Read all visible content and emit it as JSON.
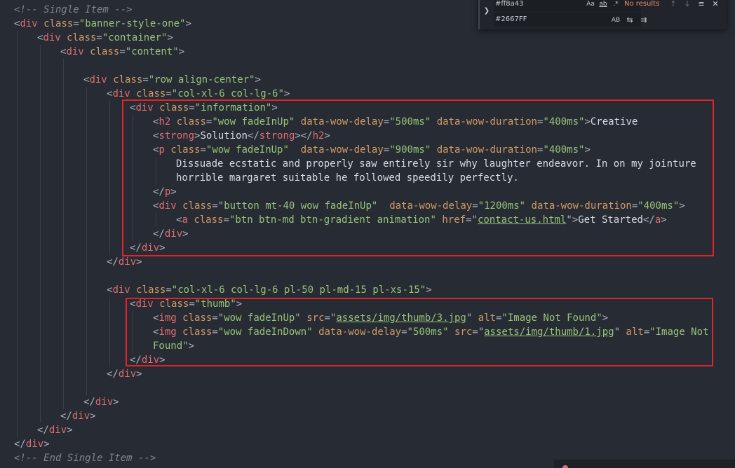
{
  "editor": {
    "lines": [
      {
        "indent": 0,
        "tokens": [
          [
            "comment",
            "<!-- Single Item -->"
          ]
        ]
      },
      {
        "indent": 0,
        "tokens": [
          [
            "punct",
            "<"
          ],
          [
            "tag",
            "div"
          ],
          [
            "punct",
            " "
          ],
          [
            "attr",
            "class"
          ],
          [
            "punct",
            "="
          ],
          [
            "string",
            "\"banner-style-one\""
          ],
          [
            "punct",
            ">"
          ]
        ]
      },
      {
        "indent": 1,
        "tokens": [
          [
            "punct",
            "<"
          ],
          [
            "tag",
            "div"
          ],
          [
            "punct",
            " "
          ],
          [
            "attr",
            "class"
          ],
          [
            "punct",
            "="
          ],
          [
            "string",
            "\"container\""
          ],
          [
            "punct",
            ">"
          ]
        ]
      },
      {
        "indent": 2,
        "tokens": [
          [
            "punct",
            "<"
          ],
          [
            "tag",
            "div"
          ],
          [
            "punct",
            " "
          ],
          [
            "attr",
            "class"
          ],
          [
            "punct",
            "="
          ],
          [
            "string",
            "\"content\""
          ],
          [
            "punct",
            ">"
          ]
        ]
      },
      {
        "indent": 3,
        "tokens": []
      },
      {
        "indent": 3,
        "tokens": [
          [
            "punct",
            "<"
          ],
          [
            "tag",
            "div"
          ],
          [
            "punct",
            " "
          ],
          [
            "attr",
            "class"
          ],
          [
            "punct",
            "="
          ],
          [
            "string",
            "\"row align-center\""
          ],
          [
            "punct",
            ">"
          ]
        ]
      },
      {
        "indent": 4,
        "tokens": [
          [
            "punct",
            "<"
          ],
          [
            "tag",
            "div"
          ],
          [
            "punct",
            " "
          ],
          [
            "attr",
            "class"
          ],
          [
            "punct",
            "="
          ],
          [
            "string",
            "\"col-xl-6 col-lg-6\""
          ],
          [
            "punct",
            ">"
          ]
        ]
      },
      {
        "indent": 5,
        "tokens": [
          [
            "punct",
            "<"
          ],
          [
            "tag",
            "div"
          ],
          [
            "punct",
            " "
          ],
          [
            "attr",
            "class"
          ],
          [
            "punct",
            "="
          ],
          [
            "string",
            "\"information\""
          ],
          [
            "punct",
            ">"
          ]
        ]
      },
      {
        "indent": 6,
        "tokens": [
          [
            "punct",
            "<"
          ],
          [
            "tag",
            "h2"
          ],
          [
            "punct",
            " "
          ],
          [
            "attr",
            "class"
          ],
          [
            "punct",
            "="
          ],
          [
            "string",
            "\"wow fadeInUp\""
          ],
          [
            "punct",
            " "
          ],
          [
            "attr",
            "data-wow-delay"
          ],
          [
            "punct",
            "="
          ],
          [
            "string",
            "\"500ms\""
          ],
          [
            "punct",
            " "
          ],
          [
            "attr",
            "data-wow-duration"
          ],
          [
            "punct",
            "="
          ],
          [
            "string",
            "\"400ms\""
          ],
          [
            "punct",
            ">"
          ],
          [
            "text",
            "Creative"
          ]
        ]
      },
      {
        "indent": 6,
        "tokens": [
          [
            "punct",
            "<"
          ],
          [
            "tag",
            "strong"
          ],
          [
            "punct",
            ">"
          ],
          [
            "text",
            "Solution"
          ],
          [
            "punct",
            "</"
          ],
          [
            "tag",
            "strong"
          ],
          [
            "punct",
            "></"
          ],
          [
            "tag",
            "h2"
          ],
          [
            "punct",
            ">"
          ]
        ]
      },
      {
        "indent": 6,
        "tokens": [
          [
            "punct",
            "<"
          ],
          [
            "tag",
            "p"
          ],
          [
            "punct",
            " "
          ],
          [
            "attr",
            "class"
          ],
          [
            "punct",
            "="
          ],
          [
            "string",
            "\"wow fadeInUp\""
          ],
          [
            "punct",
            "  "
          ],
          [
            "attr",
            "data-wow-delay"
          ],
          [
            "punct",
            "="
          ],
          [
            "string",
            "\"900ms\""
          ],
          [
            "punct",
            " "
          ],
          [
            "attr",
            "data-wow-duration"
          ],
          [
            "punct",
            "="
          ],
          [
            "string",
            "\"400ms\""
          ],
          [
            "punct",
            ">"
          ]
        ]
      },
      {
        "indent": 7,
        "tokens": [
          [
            "text",
            "Dissuade ecstatic and properly saw entirely sir why laughter endeavor. In on my jointure"
          ]
        ]
      },
      {
        "indent": 7,
        "tokens": [
          [
            "text",
            "horrible margaret suitable he followed speedily perfectly."
          ]
        ]
      },
      {
        "indent": 6,
        "tokens": [
          [
            "punct",
            "</"
          ],
          [
            "tag",
            "p"
          ],
          [
            "punct",
            ">"
          ]
        ]
      },
      {
        "indent": 6,
        "tokens": [
          [
            "punct",
            "<"
          ],
          [
            "tag",
            "div"
          ],
          [
            "punct",
            " "
          ],
          [
            "attr",
            "class"
          ],
          [
            "punct",
            "="
          ],
          [
            "string",
            "\"button mt-40 wow fadeInUp\""
          ],
          [
            "punct",
            "  "
          ],
          [
            "attr",
            "data-wow-delay"
          ],
          [
            "punct",
            "="
          ],
          [
            "string",
            "\"1200ms\""
          ],
          [
            "punct",
            " "
          ],
          [
            "attr",
            "data-wow-duration"
          ],
          [
            "punct",
            "="
          ],
          [
            "string",
            "\"400ms\""
          ],
          [
            "punct",
            ">"
          ]
        ]
      },
      {
        "indent": 7,
        "tokens": [
          [
            "punct",
            "<"
          ],
          [
            "tag",
            "a"
          ],
          [
            "punct",
            " "
          ],
          [
            "attr",
            "class"
          ],
          [
            "punct",
            "="
          ],
          [
            "string",
            "\"btn btn-md btn-gradient animation\""
          ],
          [
            "punct",
            " "
          ],
          [
            "attr",
            "href"
          ],
          [
            "punct",
            "=\""
          ],
          [
            "link",
            "contact-us.html"
          ],
          [
            "punct",
            "\">"
          ],
          [
            "text",
            "Get Started"
          ],
          [
            "punct",
            "</"
          ],
          [
            "tag",
            "a"
          ],
          [
            "punct",
            ">"
          ]
        ]
      },
      {
        "indent": 6,
        "tokens": [
          [
            "punct",
            "</"
          ],
          [
            "tag",
            "div"
          ],
          [
            "punct",
            ">"
          ]
        ]
      },
      {
        "indent": 5,
        "tokens": [
          [
            "punct",
            "</"
          ],
          [
            "tag",
            "div"
          ],
          [
            "punct",
            ">"
          ]
        ]
      },
      {
        "indent": 4,
        "tokens": [
          [
            "punct",
            "</"
          ],
          [
            "tag",
            "div"
          ],
          [
            "punct",
            ">"
          ]
        ]
      },
      {
        "indent": 4,
        "tokens": []
      },
      {
        "indent": 4,
        "tokens": [
          [
            "punct",
            "<"
          ],
          [
            "tag",
            "div"
          ],
          [
            "punct",
            " "
          ],
          [
            "attr",
            "class"
          ],
          [
            "punct",
            "="
          ],
          [
            "string",
            "\"col-xl-6 col-lg-6 pl-50 pl-md-15 pl-xs-15\""
          ],
          [
            "punct",
            ">"
          ]
        ]
      },
      {
        "indent": 5,
        "tokens": [
          [
            "punct",
            "<"
          ],
          [
            "tag",
            "div"
          ],
          [
            "punct",
            " "
          ],
          [
            "attr",
            "class"
          ],
          [
            "punct",
            "="
          ],
          [
            "string",
            "\"thumb\""
          ],
          [
            "punct",
            ">"
          ]
        ]
      },
      {
        "indent": 6,
        "tokens": [
          [
            "punct",
            "<"
          ],
          [
            "tag",
            "img"
          ],
          [
            "punct",
            " "
          ],
          [
            "attr",
            "class"
          ],
          [
            "punct",
            "="
          ],
          [
            "string",
            "\"wow fadeInUp\""
          ],
          [
            "punct",
            " "
          ],
          [
            "attr",
            "src"
          ],
          [
            "punct",
            "=\""
          ],
          [
            "link",
            "assets/img/thumb/3.jpg"
          ],
          [
            "punct",
            "\" "
          ],
          [
            "attr",
            "alt"
          ],
          [
            "punct",
            "="
          ],
          [
            "string",
            "\"Image Not Found\""
          ],
          [
            "punct",
            ">"
          ]
        ]
      },
      {
        "indent": 6,
        "tokens": [
          [
            "punct",
            "<"
          ],
          [
            "tag",
            "img"
          ],
          [
            "punct",
            " "
          ],
          [
            "attr",
            "class"
          ],
          [
            "punct",
            "="
          ],
          [
            "string",
            "\"wow fadeInDown\""
          ],
          [
            "punct",
            " "
          ],
          [
            "attr",
            "data-wow-delay"
          ],
          [
            "punct",
            "="
          ],
          [
            "string",
            "\"500ms\""
          ],
          [
            "punct",
            " "
          ],
          [
            "attr",
            "src"
          ],
          [
            "punct",
            "=\""
          ],
          [
            "link",
            "assets/img/thumb/1.jpg"
          ],
          [
            "punct",
            "\" "
          ],
          [
            "attr",
            "alt"
          ],
          [
            "punct",
            "="
          ],
          [
            "string",
            "\"Image Not"
          ]
        ]
      },
      {
        "indent": 6,
        "tokens": [
          [
            "string",
            "Found\""
          ],
          [
            "punct",
            ">"
          ]
        ]
      },
      {
        "indent": 5,
        "tokens": [
          [
            "punct",
            "</"
          ],
          [
            "tag",
            "div"
          ],
          [
            "punct",
            ">"
          ]
        ]
      },
      {
        "indent": 4,
        "tokens": [
          [
            "punct",
            "</"
          ],
          [
            "tag",
            "div"
          ],
          [
            "punct",
            ">"
          ]
        ]
      },
      {
        "indent": 4,
        "tokens": []
      },
      {
        "indent": 3,
        "tokens": [
          [
            "punct",
            "</"
          ],
          [
            "tag",
            "div"
          ],
          [
            "punct",
            ">"
          ]
        ]
      },
      {
        "indent": 2,
        "tokens": [
          [
            "punct",
            "</"
          ],
          [
            "tag",
            "div"
          ],
          [
            "punct",
            ">"
          ]
        ]
      },
      {
        "indent": 1,
        "tokens": [
          [
            "punct",
            "</"
          ],
          [
            "tag",
            "div"
          ],
          [
            "punct",
            ">"
          ]
        ]
      },
      {
        "indent": 0,
        "tokens": [
          [
            "punct",
            "</"
          ],
          [
            "tag",
            "div"
          ],
          [
            "punct",
            ">"
          ]
        ]
      },
      {
        "indent": 0,
        "tokens": [
          [
            "comment",
            "<!-- End Single Item -->"
          ]
        ]
      }
    ]
  },
  "find_widget": {
    "find_value": "#ff8a43",
    "replace_value": "#2667FF",
    "status": "No results",
    "match_case": "Aa",
    "whole_word": "ab",
    "regex": ".*",
    "preserve_case": "AB",
    "toggle_icon": "chevron-down-icon",
    "prev_icon": "arrow-up-icon",
    "next_icon": "arrow-down-icon",
    "selection_icon": "find-in-selection-icon",
    "close_icon": "close-icon",
    "replace_one_icon": "replace-icon",
    "replace_all_icon": "replace-all-icon"
  },
  "colors": {
    "background": "#272b33",
    "tag": "#e06c75",
    "attribute": "#d19a66",
    "string": "#98c379",
    "comment": "#7f848e",
    "highlight_box": "#e2232a"
  }
}
